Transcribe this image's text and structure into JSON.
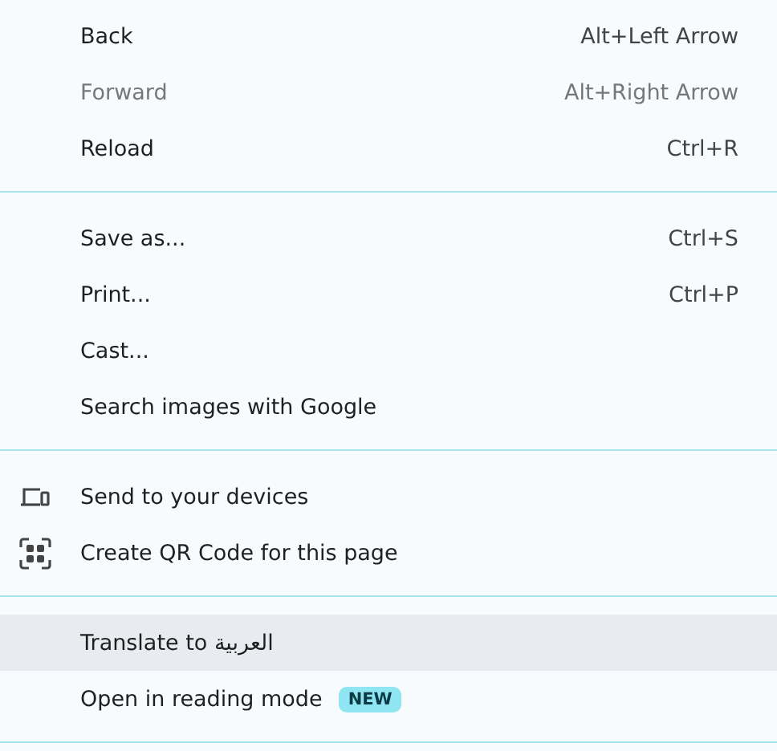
{
  "sections": [
    {
      "items": [
        {
          "kind": "plain",
          "label": "Back",
          "shortcut": "Alt+Left Arrow",
          "disabled": false,
          "selected": false
        },
        {
          "kind": "plain",
          "label": "Forward",
          "shortcut": "Alt+Right Arrow",
          "disabled": true,
          "selected": false
        },
        {
          "kind": "plain",
          "label": "Reload",
          "shortcut": "Ctrl+R",
          "disabled": false,
          "selected": false
        }
      ]
    },
    {
      "items": [
        {
          "kind": "plain",
          "label": "Save as...",
          "shortcut": "Ctrl+S",
          "disabled": false,
          "selected": false
        },
        {
          "kind": "plain",
          "label": "Print...",
          "shortcut": "Ctrl+P",
          "disabled": false,
          "selected": false
        },
        {
          "kind": "plain",
          "label": "Cast...",
          "disabled": false,
          "selected": false
        },
        {
          "kind": "plain",
          "label": "Search images with Google",
          "disabled": false,
          "selected": false
        }
      ]
    },
    {
      "items": [
        {
          "kind": "devices",
          "label": "Send to your devices",
          "disabled": false,
          "selected": false
        },
        {
          "kind": "qr",
          "label": "Create QR Code for this page",
          "disabled": false,
          "selected": false
        }
      ]
    },
    {
      "items": [
        {
          "kind": "plain",
          "label": "Translate to العربية",
          "disabled": false,
          "selected": true
        },
        {
          "kind": "plain",
          "label": "Open in reading mode",
          "badge": "NEW",
          "disabled": false,
          "selected": false
        }
      ]
    }
  ]
}
